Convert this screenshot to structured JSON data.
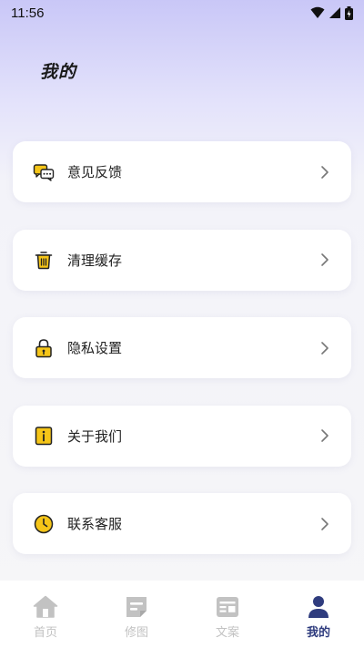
{
  "status_bar": {
    "time": "11:56"
  },
  "page": {
    "title": "我的"
  },
  "menu": {
    "items": [
      {
        "label": "意见反馈",
        "icon": "feedback-icon"
      },
      {
        "label": "清理缓存",
        "icon": "trash-icon"
      },
      {
        "label": "隐私设置",
        "icon": "lock-icon"
      },
      {
        "label": "关于我们",
        "icon": "info-icon"
      },
      {
        "label": "联系客服",
        "icon": "clock-icon"
      }
    ]
  },
  "tabs": [
    {
      "label": "首页",
      "icon": "home-icon",
      "active": false
    },
    {
      "label": "修图",
      "icon": "edit-image-icon",
      "active": false
    },
    {
      "label": "文案",
      "icon": "copywriting-icon",
      "active": false
    },
    {
      "label": "我的",
      "icon": "profile-icon",
      "active": true
    }
  ],
  "colors": {
    "accent": "#2f3c7e",
    "icon_yellow": "#f5c518",
    "tab_inactive": "#c2c2c2"
  }
}
